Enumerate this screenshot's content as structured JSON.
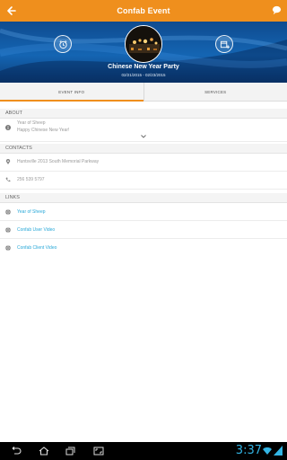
{
  "topbar": {
    "title": "Confab Event",
    "back_icon": "back-arrow-icon",
    "chat_icon": "chat-bubble-icon"
  },
  "hero": {
    "event_name": "Chinese New Year Party",
    "event_dates": "02/21/2015 - 02/23/2015"
  },
  "tabs": [
    {
      "label": "EVENT INFO",
      "active": true
    },
    {
      "label": "SERVICES",
      "active": false
    }
  ],
  "about": {
    "header": "ABOUT",
    "title": "Year of Sheep",
    "description": "Happy Chinese New Year!"
  },
  "contacts": {
    "header": "CONTACTS",
    "address": "Huntsville 2013 South Memorial Parkway",
    "phone": "256 539 5797"
  },
  "links": {
    "header": "LINKS",
    "items": [
      "Year of Sheep",
      "Confab User Video",
      "Confab Client Video"
    ]
  },
  "statusbar": {
    "time": "3:37"
  },
  "colors": {
    "accent": "#ef8f1d",
    "link": "#29a8d8",
    "hero": "#1465b3"
  }
}
